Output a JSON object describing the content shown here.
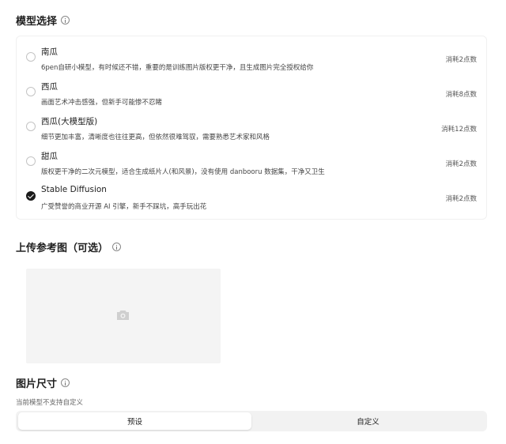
{
  "model_section": {
    "title": "模型选择",
    "icon": "info-icon",
    "models": [
      {
        "name": "南瓜",
        "desc": "6pen自研小模型，有时候还不错，重要的是训练图片版权更干净，且生成图片完全授权给你",
        "cost": "消耗2点数",
        "selected": false
      },
      {
        "name": "西瓜",
        "desc": "画面艺术冲击感强，但新手可能惨不忍睹",
        "cost": "消耗8点数",
        "selected": false
      },
      {
        "name": "西瓜(大模型版)",
        "desc": "细节更加丰富，清晰度也往往更高，但依然很难驾驭，需要熟悉艺术家和风格",
        "cost": "消耗12点数",
        "selected": false
      },
      {
        "name": "甜瓜",
        "desc": "版权更干净的二次元模型，适合生成纸片人(和风景)，没有使用 danbooru 数据集，干净又卫生",
        "cost": "消耗2点数",
        "selected": false
      },
      {
        "name": "Stable Diffusion",
        "desc": "广受赞誉的商业开源 AI 引擎，新手不踩坑，高手玩出花",
        "cost": "消耗2点数",
        "selected": true
      }
    ]
  },
  "upload_section": {
    "title": "上传参考图（可选）",
    "icon": "info-icon",
    "placeholder_icon": "camera-icon"
  },
  "size_section": {
    "title": "图片尺寸",
    "icon": "info-icon",
    "note": "当前模型不支持自定义",
    "options": [
      {
        "label": "预设",
        "active": true
      },
      {
        "label": "自定义",
        "active": false
      }
    ]
  }
}
